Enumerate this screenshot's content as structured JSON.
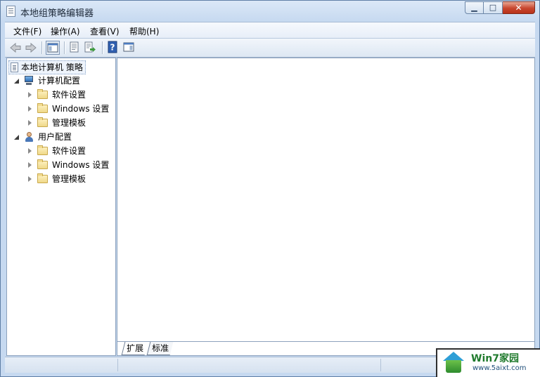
{
  "window": {
    "title": "本地组策略编辑器",
    "minimize_glyph": "▁",
    "maximize_glyph": "□",
    "close_glyph": "✕"
  },
  "menu": [
    {
      "label": "文件(F)"
    },
    {
      "label": "操作(A)"
    },
    {
      "label": "查看(V)"
    },
    {
      "label": "帮助(H)"
    }
  ],
  "toolbar": {
    "icons": [
      "back-arrow-icon",
      "forward-arrow-icon",
      "show-hide-tree-icon",
      "properties-icon",
      "export-list-icon",
      "help-icon",
      "action-pane-icon"
    ],
    "help_glyph": "?"
  },
  "tree": {
    "root": {
      "label": "本地计算机 策略"
    },
    "computer_config": {
      "label": "计算机配置",
      "children": [
        {
          "label": "软件设置"
        },
        {
          "label": "Windows 设置"
        },
        {
          "label": "管理模板"
        }
      ]
    },
    "user_config": {
      "label": "用户配置",
      "children": [
        {
          "label": "软件设置"
        },
        {
          "label": "Windows 设置"
        },
        {
          "label": "管理模板"
        }
      ]
    }
  },
  "tabs": [
    {
      "label": "扩展",
      "active": true
    },
    {
      "label": "标准",
      "active": false
    }
  ],
  "watermark": {
    "title": "Win7家园",
    "url": "www.5aixt.com"
  },
  "colors": {
    "titlebar": "#c6d9f0",
    "close_button": "#c8462e",
    "selection_border": "#7f9dc4",
    "folder": "#efd889"
  }
}
